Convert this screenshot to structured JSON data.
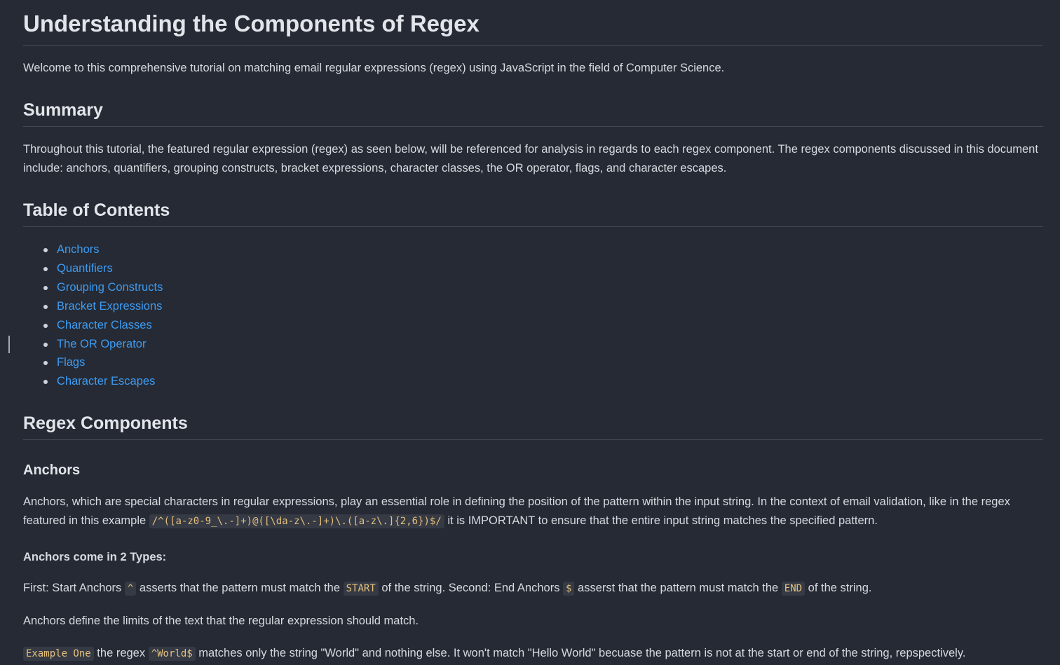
{
  "title": "Understanding the Components of Regex",
  "intro": "Welcome to this comprehensive tutorial on matching email regular expressions (regex) using JavaScript in the field of Computer Science.",
  "summary": {
    "heading": "Summary",
    "text": "Throughout this tutorial, the featured regular expression (regex) as seen below, will be referenced for analysis in regards to each regex component. The regex components discussed in this document include: anchors, quantifiers, grouping constructs, bracket expressions, character classes, the OR operator, flags, and character escapes."
  },
  "toc": {
    "heading": "Table of Contents",
    "items": [
      "Anchors",
      "Quantifiers",
      "Grouping Constructs",
      "Bracket Expressions",
      "Character Classes",
      "The OR Operator",
      "Flags",
      "Character Escapes"
    ]
  },
  "regex_components": {
    "heading": "Regex Components"
  },
  "anchors": {
    "heading": "Anchors",
    "p1_before": "Anchors, which are special characters in regular expressions, play an essential role in defining the position of the pattern within the input string. In the context of email validation, like in the regex featured in this example ",
    "regex": "/^([a-z0-9_\\.-]+)@([\\da-z\\.-]+)\\.([a-z\\.]{2,6})$/",
    "p1_after": " it is IMPORTANT to ensure that the entire input string matches the specified pattern.",
    "types_heading": "Anchors come in 2 Types:",
    "p2_a": "First: Start Anchors ",
    "code_caret": "^",
    "p2_b": " asserts that the pattern must match the ",
    "code_start": "START",
    "p2_c": " of the string. Second: End Anchors ",
    "code_dollar": "$",
    "p2_d": " asserst that the pattern must match the ",
    "code_end": "END",
    "p2_e": " of the string.",
    "limits": "Anchors define the limits of the text that the regular expression should match.",
    "ex_code": "Example One",
    "ex_a": " the regex ",
    "ex_code2": "^World$",
    "ex_b": " matches only the string \"World\" and nothing else. It won't match \"Hello World\" becuase the pattern is not at the start or end of the string, repspectively."
  }
}
